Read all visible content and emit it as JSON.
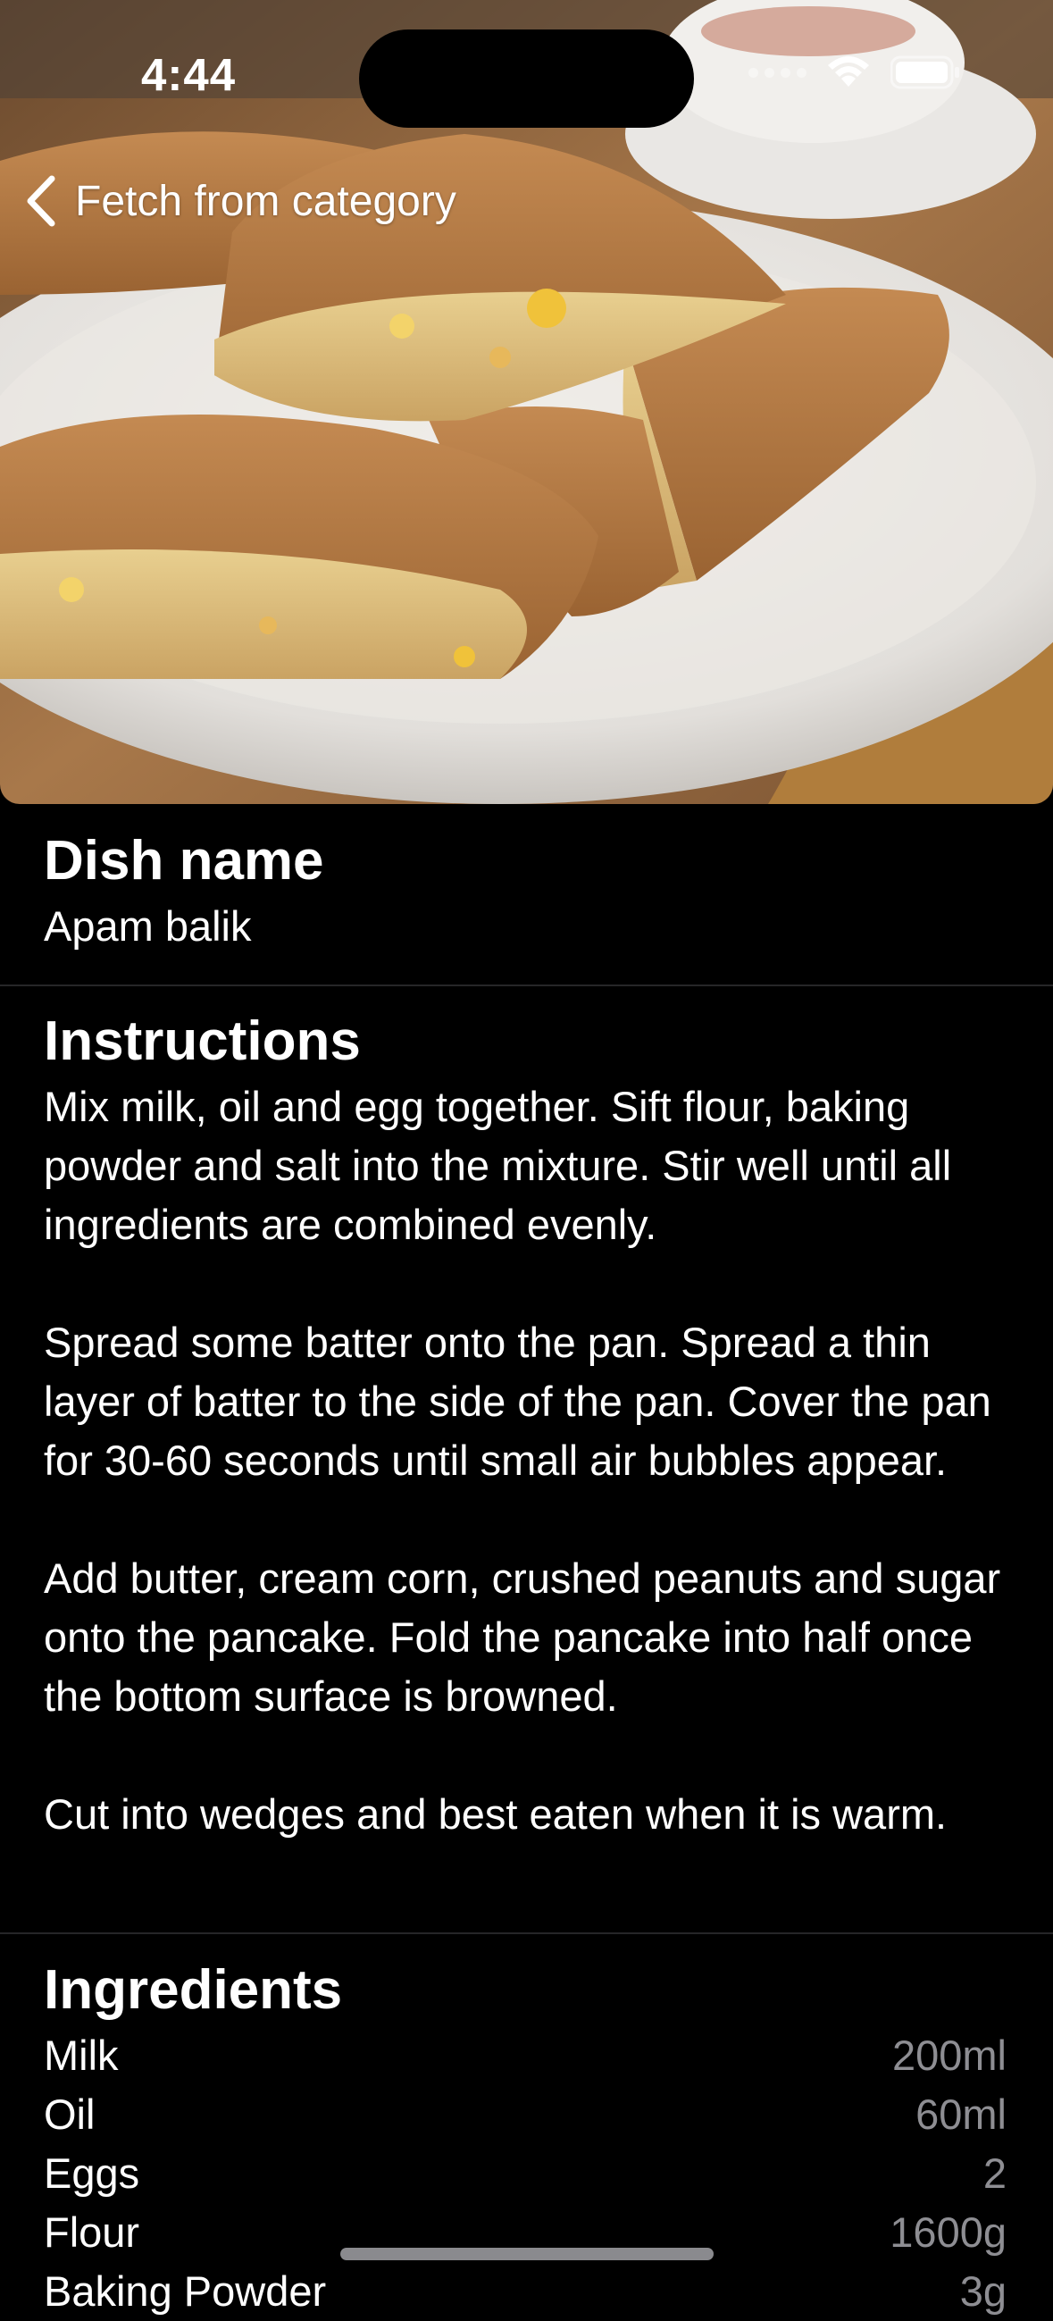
{
  "status_bar": {
    "time": "4:44"
  },
  "nav": {
    "back_label": "Fetch from category"
  },
  "dish": {
    "heading": "Dish name",
    "name": "Apam balik"
  },
  "instructions": {
    "heading": "Instructions",
    "paragraphs": [
      "Mix milk, oil and egg together. Sift flour, baking powder and salt into the mixture. Stir well until all ingredients are combined evenly.",
      "Spread some batter onto the pan. Spread a thin layer of batter to the side of the pan. Cover the pan for 30-60 seconds until small air bubbles appear.",
      "Add butter, cream corn, crushed peanuts and sugar onto the pancake. Fold the pancake into half once the bottom surface is browned.",
      "Cut into wedges and best eaten when it is warm."
    ]
  },
  "ingredients": {
    "heading": "Ingredients",
    "items": [
      {
        "name": "Milk",
        "measure": "200ml"
      },
      {
        "name": "Oil",
        "measure": "60ml"
      },
      {
        "name": "Eggs",
        "measure": "2"
      },
      {
        "name": "Flour",
        "measure": "1600g"
      },
      {
        "name": "Baking Powder",
        "measure": "3g"
      }
    ]
  },
  "colors": {
    "background": "#000000",
    "text": "#ffffff",
    "secondary_text": "#8e8e93",
    "divider": "#262628"
  }
}
